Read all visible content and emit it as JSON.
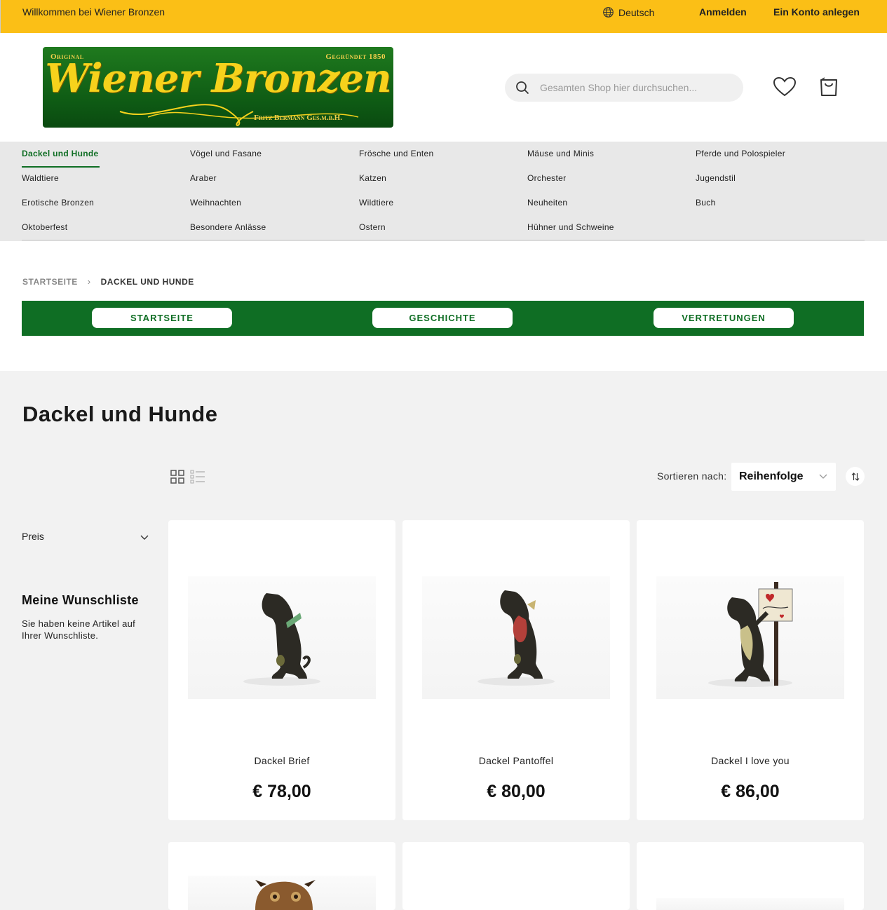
{
  "topbar": {
    "welcome": "Willkommen bei Wiener Bronzen",
    "language": "Deutsch",
    "signin": "Anmelden",
    "register": "Ein Konto anlegen"
  },
  "logo": {
    "original": "Original",
    "founded": "Gegründet 1850",
    "brand": "Wiener Bronzen",
    "company": "Fritz Bermann Ges.m.b.H."
  },
  "search": {
    "placeholder": "Gesamten Shop hier durchsuchen..."
  },
  "categories": [
    "Dackel und Hunde",
    "Vögel und Fasane",
    "Frösche und Enten",
    "Mäuse und Minis",
    "Pferde und Polospieler",
    "Waldtiere",
    "Araber",
    "Katzen",
    "Orchester",
    "Jugendstil",
    "Erotische Bronzen",
    "Weihnachten",
    "Wildtiere",
    "Neuheiten",
    "Buch",
    "Oktoberfest",
    "Besondere Anlässe",
    "Ostern",
    "Hühner und Schweine"
  ],
  "breadcrumb": {
    "home": "STARTSEITE",
    "current": "DACKEL UND HUNDE"
  },
  "greenbar": {
    "buttons": [
      "STARTSEITE",
      "GESCHICHTE",
      "VERTRETUNGEN"
    ]
  },
  "page": {
    "title": "Dackel und Hunde"
  },
  "toolbar": {
    "sort_label": "Sortieren nach:",
    "sort_value": "Reihenfolge"
  },
  "sidebar": {
    "filter_price": "Preis",
    "wishlist_title": "Meine Wunschliste",
    "wishlist_empty": "Sie haben keine Artikel auf Ihrer Wunschliste."
  },
  "products": [
    {
      "name": "Dackel Brief",
      "price": "€ 78,00"
    },
    {
      "name": "Dackel Pantoffel",
      "price": "€ 80,00"
    },
    {
      "name": "Dackel I love you",
      "price": "€ 86,00"
    }
  ],
  "colors": {
    "topbar": "#fbbf16",
    "brand_green": "#0f6e24",
    "nav_bg": "#e8e8e8",
    "main_bg": "#f2f2f2"
  }
}
